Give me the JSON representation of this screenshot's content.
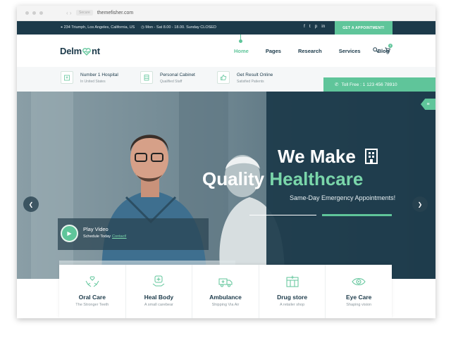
{
  "browser": {
    "url": "themefisher.com",
    "secure_label": "Secure"
  },
  "topbar": {
    "address": "234 Triumph, Los Angeles, California, US",
    "hours": "Mon - Sat 8.00 - 18.00. Sunday CLOSED",
    "social_icons": [
      "f",
      "t",
      "p",
      "in"
    ],
    "appointment_button": "GET A APPOINTMENT!"
  },
  "nav": {
    "logo_left": "Delm",
    "logo_right": "nt",
    "links": [
      "Home",
      "Pages",
      "Research",
      "Services",
      "Blog"
    ],
    "active_index": 0,
    "cart_count": "0"
  },
  "features": [
    {
      "title": "Number 1 Hospital",
      "subtitle": "In United States",
      "icon": "hospital-icon"
    },
    {
      "title": "Personal Cabinet",
      "subtitle": "Qualified Staff",
      "icon": "cabinet-icon"
    },
    {
      "title": "Get Result Online",
      "subtitle": "Satisfied Patients",
      "icon": "thumbs-up-icon"
    }
  ],
  "tollfree": "Toll Free : 1 123 456 78910",
  "hero": {
    "title_line1": "We Make",
    "title_line2_plain": "Quality",
    "title_line2_accent": "Healthcare",
    "subtitle": "Same-Day Emergency Appointments!",
    "play_title": "Play Video",
    "play_subtitle": "Schedule Today",
    "play_link": "Contact!"
  },
  "services": [
    {
      "title": "Oral Care",
      "subtitle": "The Stronger Teeth",
      "icon": "hands-heart-icon"
    },
    {
      "title": "Heal Body",
      "subtitle": "A small carebear",
      "icon": "heal-body-icon"
    },
    {
      "title": "Ambulance",
      "subtitle": "Shipping Via Air",
      "icon": "ambulance-icon"
    },
    {
      "title": "Drug store",
      "subtitle": "A retailer shop",
      "icon": "drugstore-icon"
    },
    {
      "title": "Eye Care",
      "subtitle": "Shaping vision",
      "icon": "eye-icon"
    }
  ],
  "colors": {
    "navy": "#1c3a4a",
    "accent": "#5fc59a"
  }
}
